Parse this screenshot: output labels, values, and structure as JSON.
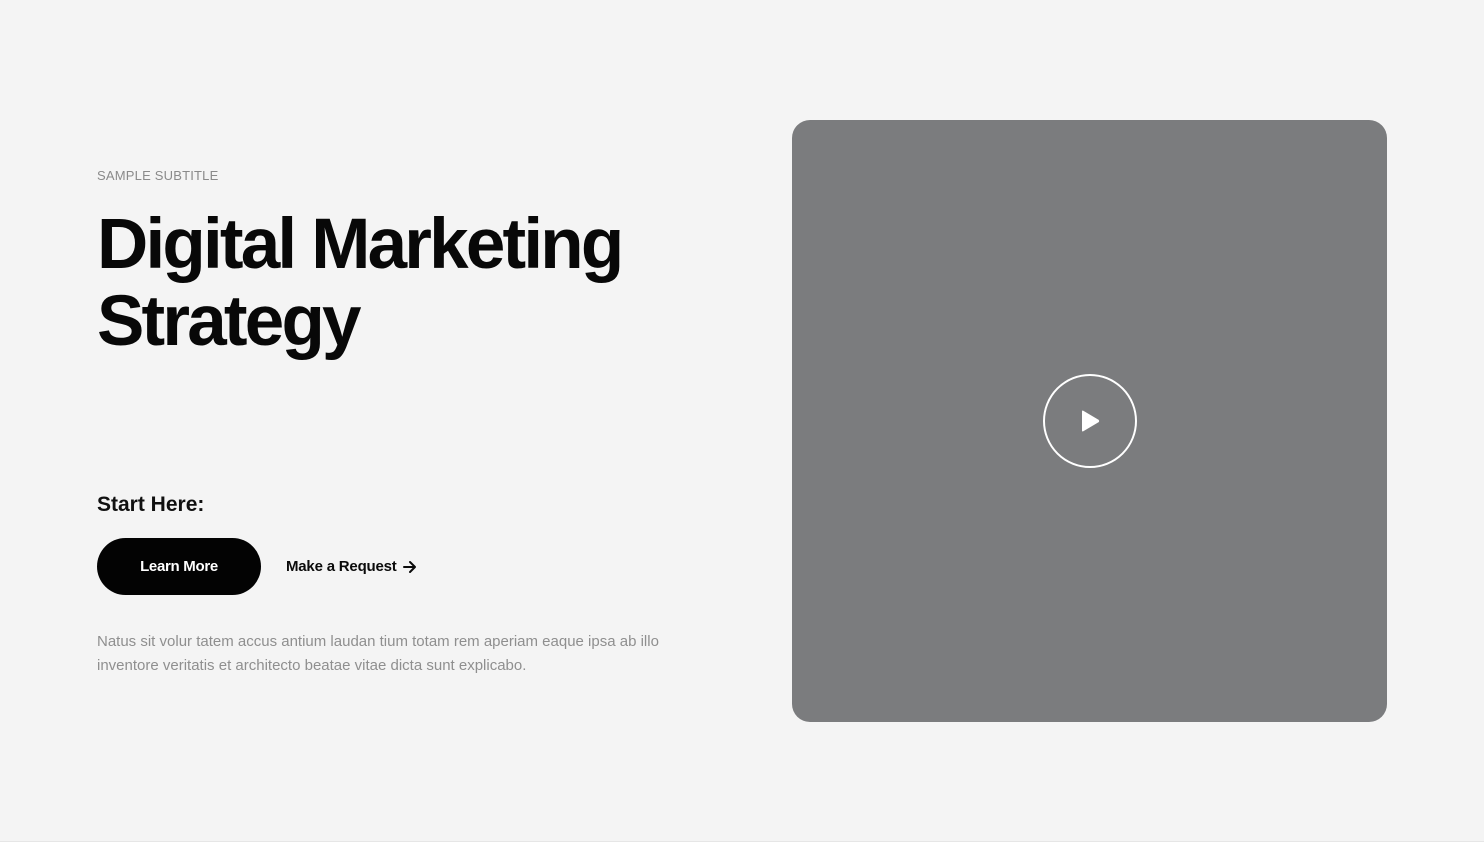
{
  "hero": {
    "subtitle": "SAMPLE SUBTITLE",
    "title": "Digital Marketing Strategy",
    "start_label": "Start Here:",
    "primary_button": "Learn More",
    "secondary_link": "Make a Request",
    "secondary_link_icon": "arrow-right-icon",
    "description": "Natus sit volur tatem accus antium laudan tium totam rem aperiam eaque ipsa ab illo inventore veritatis et architecto beatae vitae dicta sunt explicabo."
  },
  "media": {
    "play_icon": "play-icon",
    "placeholder_color": "#7b7c7e"
  },
  "colors": {
    "background": "#f4f4f4",
    "primary_button_bg": "#030303",
    "text_muted": "#8f8f8f"
  }
}
